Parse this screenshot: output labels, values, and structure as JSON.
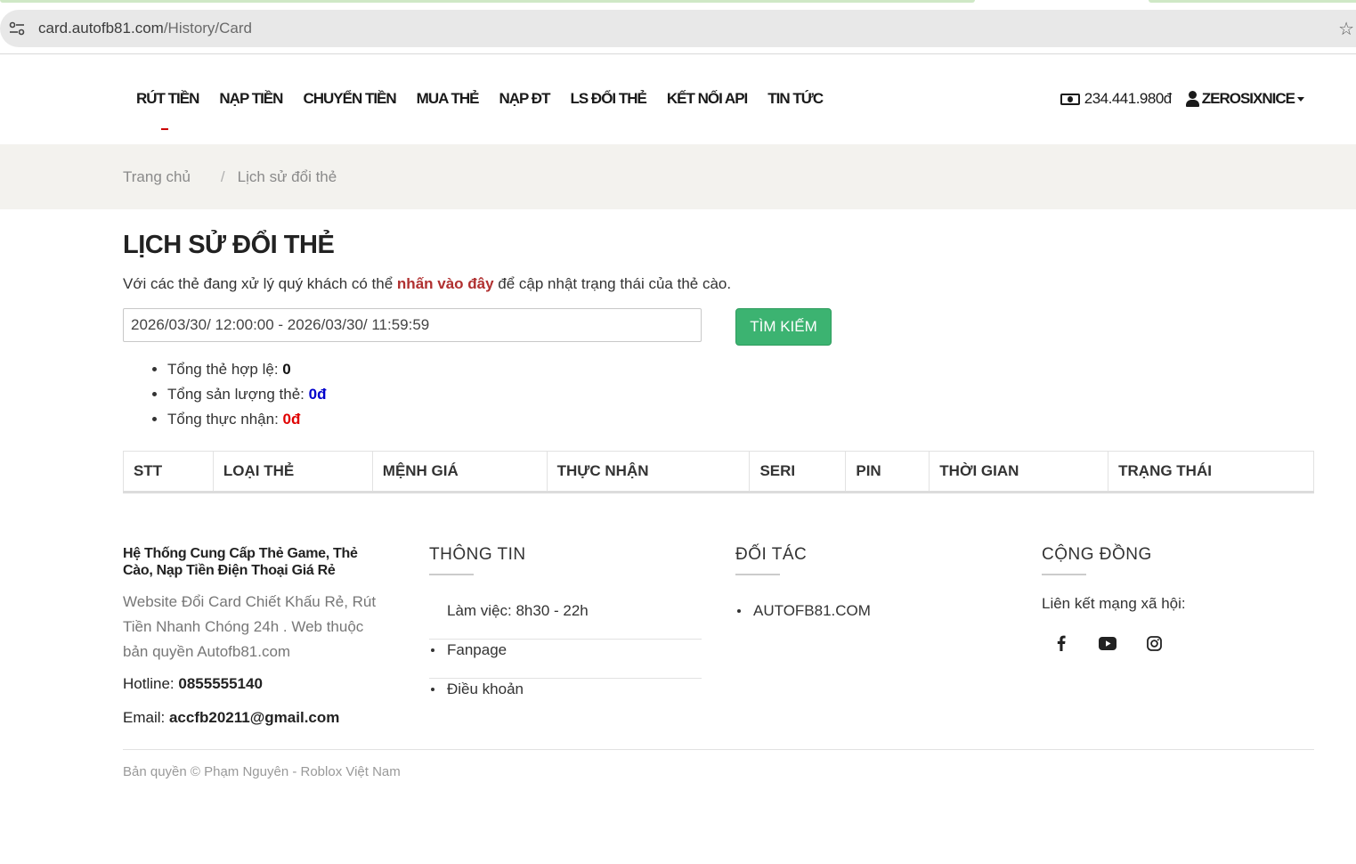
{
  "browser": {
    "url_domain": "card.autofb81.com",
    "url_path": "/History/Card"
  },
  "nav": {
    "items": [
      "RÚT TIỀN",
      "NẠP TIỀN",
      "CHUYỂN TIỀN",
      "MUA THẺ",
      "NẠP ĐT",
      "LS ĐỔI THẺ",
      "KẾT NỐI API",
      "TIN TỨC"
    ],
    "balance": "234.441.980đ",
    "username": "ZEROSIXNICE"
  },
  "breadcrumb": {
    "home": "Trang chủ",
    "separator": "/",
    "current": "Lịch sử đổi thẻ"
  },
  "main": {
    "title": "LỊCH SỬ ĐỔI THẺ",
    "intro_before": "Với các thẻ đang xử lý quý khách có thể ",
    "intro_link": "nhấn vào đây",
    "intro_after": " để cập nhật trạng thái của thẻ cào.",
    "date_range_value": "2026/03/30/ 12:00:00 - 2026/03/30/ 11:59:59",
    "search_label": "TÌM KIẾM",
    "stats": [
      {
        "label": "Tổng thẻ hợp lệ: ",
        "value": "0"
      },
      {
        "label": "Tổng sản lượng thẻ: ",
        "value": "0đ"
      },
      {
        "label": "Tổng thực nhận: ",
        "value": "0đ"
      }
    ],
    "table_headers": [
      "STT",
      "LOẠI THẺ",
      "MỆNH GIÁ",
      "THỰC NHẬN",
      "SERI",
      "PIN",
      "THỜI GIAN",
      "TRẠNG THÁI"
    ]
  },
  "footer": {
    "brand_name": "Hệ Thống Cung Cấp Thẻ Game, Thẻ Cào, Nạp Tiền Điện Thoại Giá Rẻ",
    "brand_desc": "Website Đổi Card Chiết Khấu Rẻ, Rút Tiền Nhanh Chóng 24h . Web thuộc bản quyền Autofb81.com",
    "hotline_label": "Hotline: ",
    "hotline": "0855555140",
    "email_label": "Email: ",
    "email": "accfb20211@gmail.com",
    "info_heading": "THÔNG TIN",
    "info_items": [
      "Làm việc: 8h30 - 22h",
      "Fanpage",
      "Điều khoản"
    ],
    "partner_heading": "ĐỐI TÁC",
    "partner_items": [
      "AUTOFB81.COM"
    ],
    "community_heading": "CỘNG ĐỒNG",
    "social_label": "Liên kết mạng xã hội:",
    "social_icons": [
      "facebook-icon",
      "youtube-icon",
      "instagram-icon"
    ],
    "copyright": "Bản quyền © Phạm Nguyên - Roblox Việt Nam"
  },
  "colors": {
    "accent_green": "#3cb371",
    "link_red": "#b03030",
    "value_blue": "#0000cc",
    "value_red": "#e00000",
    "breadcrumb_bg": "#f3f2ee"
  }
}
